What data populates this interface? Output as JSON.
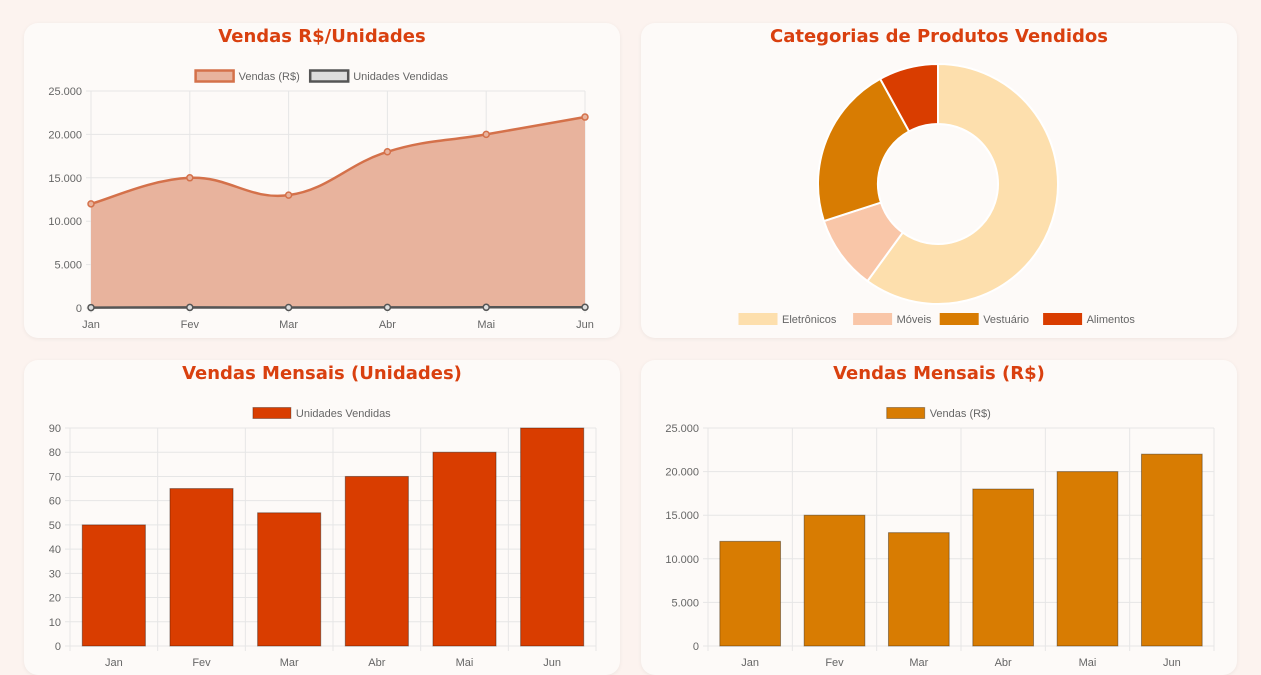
{
  "colors": {
    "accent": "#d9400f",
    "sales_line": "#d4714a",
    "sales_fill": "#e8b39d",
    "units_line": "#555555",
    "units_bar": "#d93d00",
    "sales_bar": "#d87c02",
    "grid": "#e6e6e6"
  },
  "charts": {
    "area": {
      "title": "Vendas R$/Unidades"
    },
    "donut": {
      "title": "Categorias de Produtos Vendidos"
    },
    "units_bar": {
      "title": "Vendas Mensais (Unidades)"
    },
    "sales_bar": {
      "title": "Vendas Mensais (R$)"
    }
  },
  "chart_data": [
    {
      "type": "line",
      "title": "Vendas R$/Unidades",
      "categories": [
        "Jan",
        "Fev",
        "Mar",
        "Abr",
        "Mai",
        "Jun"
      ],
      "series": [
        {
          "name": "Vendas (R$)",
          "values": [
            12000,
            15000,
            13000,
            18000,
            20000,
            22000
          ],
          "fill": true,
          "color": "#d4714a",
          "fill_color": "#e8b39d"
        },
        {
          "name": "Unidades Vendidas",
          "values": [
            50,
            65,
            55,
            70,
            80,
            90
          ],
          "fill": false,
          "color": "#555555",
          "fill_color": "#dddddd"
        }
      ],
      "ylim": [
        0,
        25000
      ],
      "yticks": [
        "0",
        "5.000",
        "10.000",
        "15.000",
        "20.000",
        "25.000"
      ],
      "grid": true,
      "legend": "top"
    },
    {
      "type": "pie",
      "title": "Categorias de Produtos Vendidos",
      "categories": [
        "Eletrônicos",
        "Móveis",
        "Vestuário",
        "Alimentos"
      ],
      "values": [
        60,
        10,
        22,
        8
      ],
      "colors": [
        "#fddfad",
        "#f9c6a8",
        "#d87c02",
        "#d93d00"
      ],
      "donut": true,
      "legend": "bottom"
    },
    {
      "type": "bar",
      "title": "Vendas Mensais (Unidades)",
      "categories": [
        "Jan",
        "Fev",
        "Mar",
        "Abr",
        "Mai",
        "Jun"
      ],
      "series": [
        {
          "name": "Unidades Vendidas",
          "values": [
            50,
            65,
            55,
            70,
            80,
            90
          ],
          "color": "#d93d00"
        }
      ],
      "ylim": [
        0,
        90
      ],
      "yticks": [
        "0",
        "10",
        "20",
        "30",
        "40",
        "50",
        "60",
        "70",
        "80",
        "90"
      ],
      "grid": true,
      "legend": "top"
    },
    {
      "type": "bar",
      "title": "Vendas Mensais (R$)",
      "categories": [
        "Jan",
        "Fev",
        "Mar",
        "Abr",
        "Mai",
        "Jun"
      ],
      "series": [
        {
          "name": "Vendas (R$)",
          "values": [
            12000,
            15000,
            13000,
            18000,
            20000,
            22000
          ],
          "color": "#d87c02"
        }
      ],
      "ylim": [
        0,
        25000
      ],
      "yticks": [
        "0",
        "5.000",
        "10.000",
        "15.000",
        "20.000",
        "25.000"
      ],
      "grid": true,
      "legend": "top"
    }
  ]
}
